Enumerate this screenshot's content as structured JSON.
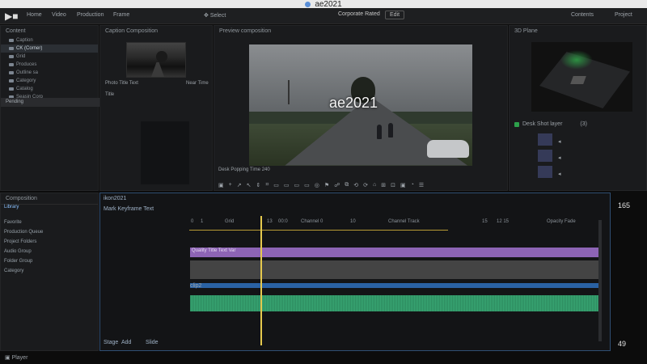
{
  "window": {
    "title": "ae2021"
  },
  "toolbar": {
    "logo": "▶■",
    "menu": [
      "Home",
      "Video",
      "Production",
      "Frame"
    ],
    "center": "Select",
    "project": "Corporate Rated",
    "badge": "Edit",
    "right": [
      "Contents",
      "Project"
    ]
  },
  "browser": {
    "title": "Content",
    "items": [
      "Caption",
      "CK (Corner)",
      "Grid",
      "Produces",
      "Outline sa",
      "Category",
      "Catalog",
      "Seasin Corp"
    ],
    "pending": "Pending"
  },
  "source": {
    "title": "Caption Composition",
    "left_note": "Photo Title Text",
    "right_note": "Near Time",
    "sub_title": "Title"
  },
  "viewer": {
    "title": "Preview composition",
    "overlay": "ae2021",
    "caption": "Desk Popping Time 240",
    "tools": [
      "▣",
      "+",
      "↗",
      "↖",
      "⇕",
      "⌗",
      "▭",
      "▭",
      "▭",
      "▭",
      "◎",
      "⚑",
      "☍",
      "⧉",
      "⟲",
      "⟳",
      "⌂",
      "⊞",
      "⊡",
      "▣",
      "◔",
      "☰"
    ]
  },
  "right_panel": {
    "title": "3D Plane",
    "list_title": "Desk Shot layer",
    "list_badge": "(3)",
    "icons": [
      "◂",
      "◂",
      "◂"
    ]
  },
  "lower_left": {
    "title": "Composition",
    "tab": "Library",
    "items": [
      "Favorite",
      "Production Queue",
      "Project Folders",
      "Audio Group",
      "Folder Group",
      "Category"
    ]
  },
  "timeline": {
    "title": "ikon2021",
    "sub": "Mark Keyframe Text",
    "markers": [
      "0",
      "1",
      "Grid",
      "13",
      "00:0",
      "Channel 0",
      "10",
      "Channel Track",
      "15",
      "12 15",
      "Opacity Fade"
    ],
    "purple_label": "Quality Title Text Var",
    "blue_label": "clip2",
    "footer": [
      "Stage",
      "Add",
      "Slide"
    ],
    "scale": [
      "1.2",
      "1"
    ]
  },
  "right_numbers": {
    "top": "165",
    "bottom": "49"
  },
  "footer": {
    "left": "Player"
  }
}
